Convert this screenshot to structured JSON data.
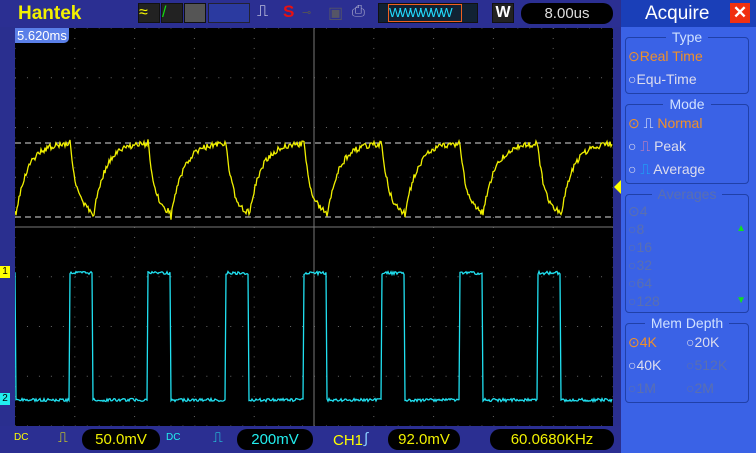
{
  "header": {
    "brand": "Hantek",
    "timebase": "8.00us",
    "trigger_position": "5.620ms",
    "run_indicator": "S",
    "window_label": "W"
  },
  "footer": {
    "ch1": {
      "coupling": "DC",
      "volts_div": "50.0mV"
    },
    "ch2": {
      "coupling": "DC",
      "volts_div": "200mV"
    },
    "trigger": {
      "source": "CH1",
      "level": "92.0mV"
    },
    "frequency": "60.0680KHz"
  },
  "markers": {
    "ch1": "1",
    "ch2": "2"
  },
  "colors": {
    "ch1": "#f0f000",
    "ch2": "#20e0f0",
    "panel": "#3a62e6",
    "selected": "#f0902a"
  },
  "panel": {
    "title": "Acquire",
    "type": {
      "label": "Type",
      "options": [
        "Real Time",
        "Equ-Time"
      ],
      "selected": "Real Time"
    },
    "mode": {
      "label": "Mode",
      "options": [
        "Normal",
        "Peak",
        "Average"
      ],
      "selected": "Normal"
    },
    "averages": {
      "label": "Averages",
      "options": [
        "4",
        "8",
        "16",
        "32",
        "64",
        "128"
      ],
      "selected": "4",
      "enabled": false
    },
    "mem_depth": {
      "label": "Mem Depth",
      "options": [
        "4K",
        "20K",
        "40K",
        "512K",
        "1M",
        "2M"
      ],
      "selected": "4K"
    }
  }
}
